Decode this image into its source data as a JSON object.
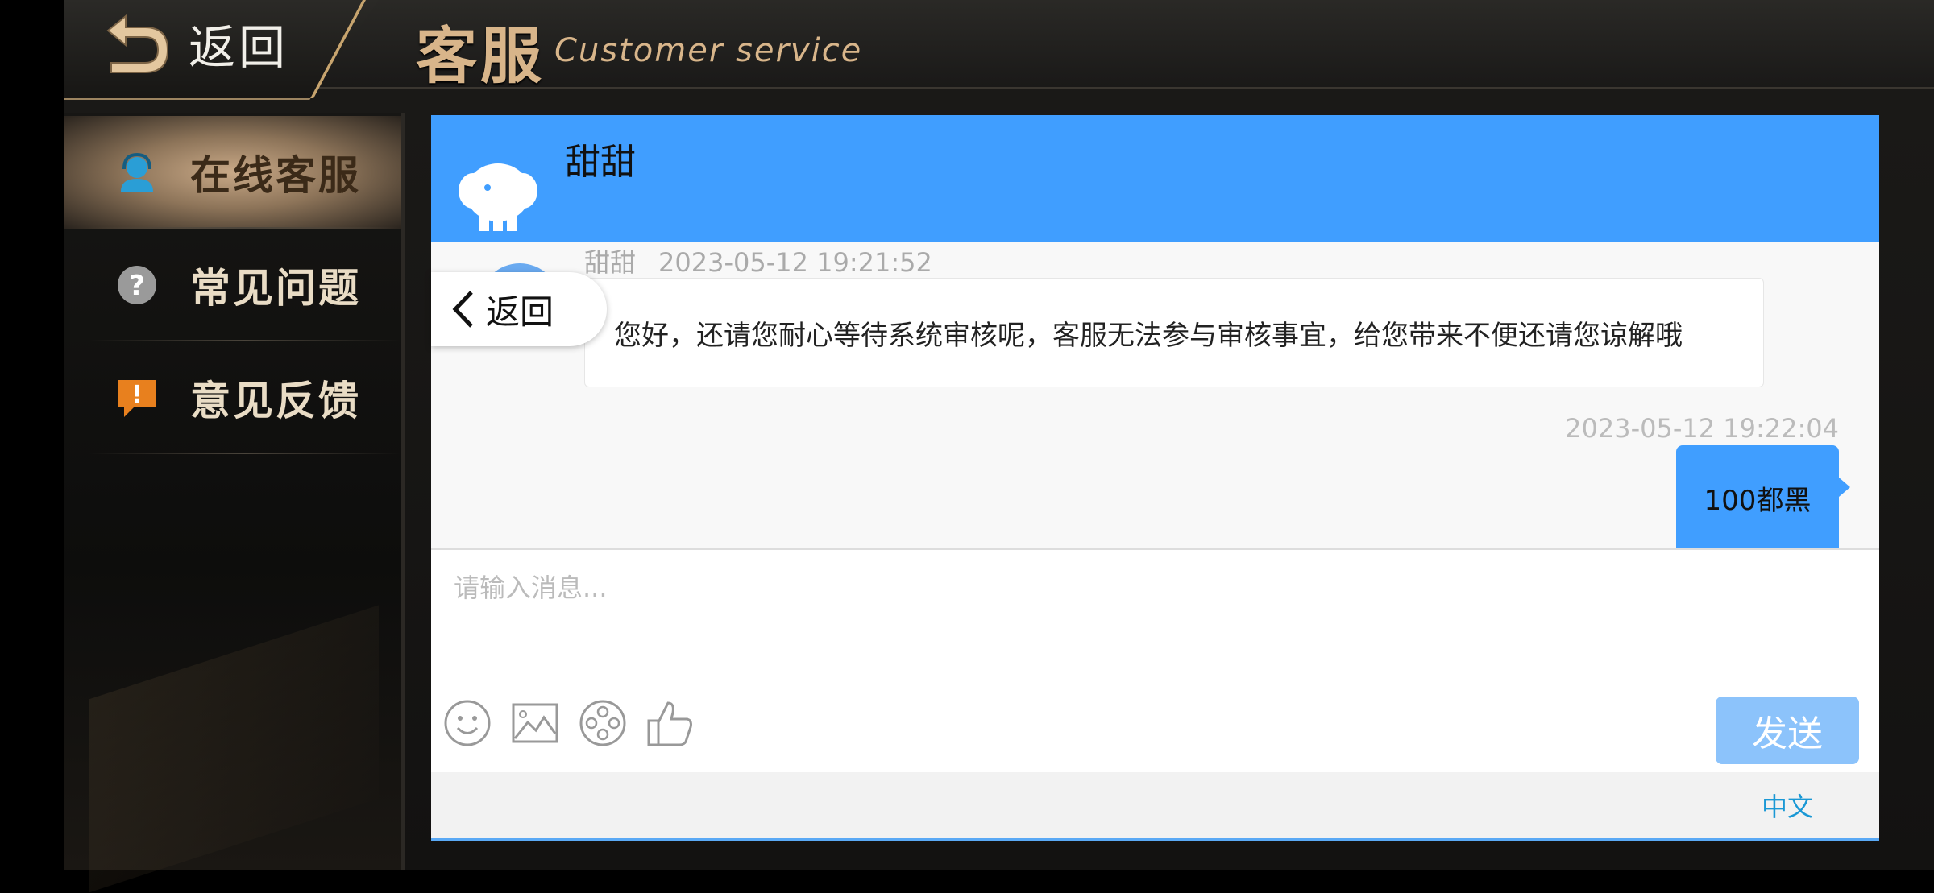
{
  "topbar": {
    "back_label": "返回",
    "title_cn": "客服",
    "title_en": "Customer service"
  },
  "sidebar": {
    "items": [
      {
        "label": "在线客服",
        "icon": "headset-agent-icon",
        "active": true
      },
      {
        "label": "常见问题",
        "icon": "question-mark-icon",
        "active": false
      },
      {
        "label": "意见反馈",
        "icon": "exclamation-feedback-icon",
        "active": false
      }
    ]
  },
  "chat": {
    "header_color": "#409eff",
    "agent_name": "甜甜",
    "messages": [
      {
        "sender": "甜甜",
        "time": "2023-05-12 19:21:52",
        "text": "您好，还请您耐心等待系统审核呢，客服无法参与审核事宜，给您带来不便还请您谅解哦",
        "direction": "in"
      },
      {
        "sender": "",
        "time": "2023-05-12 19:22:04",
        "text": "100都黑",
        "direction": "out"
      }
    ],
    "input": {
      "value": "",
      "placeholder": "请输入消息..."
    },
    "tools": [
      "emoji-icon",
      "image-icon",
      "video-reel-icon",
      "thumbs-up-icon"
    ],
    "send_label": "发送",
    "language_label": "中文"
  },
  "float_back": {
    "label": "返回"
  },
  "colors": {
    "accent": "#409eff",
    "gold": "#d8b58a",
    "send": "#8cc3fb",
    "lang_link": "#1a98d5"
  }
}
